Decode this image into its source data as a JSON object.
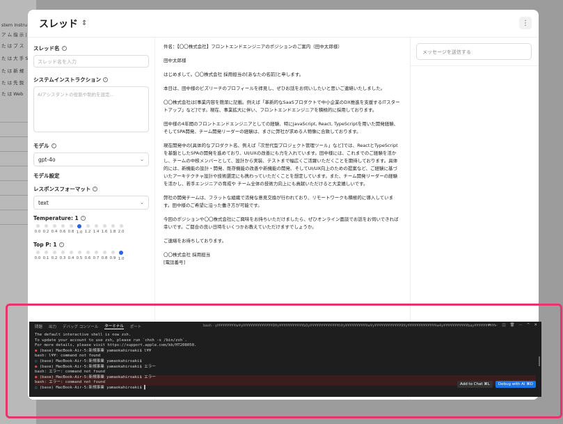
{
  "background_sidebar": [
    "stem Instru",
    "ア ム 指 示 |",
    "た は ブ ス",
    "た は 大 手 S",
    "た は 新 規",
    "た は 先 鋭",
    "た は Web"
  ],
  "modal": {
    "title": "スレッド",
    "thread_name_label": "スレッド名",
    "thread_name_placeholder": "スレッド名を入力",
    "system_instruction_label": "システムインストラクション",
    "system_instruction_placeholder": "AIアシスタントの役割や制約を設定...",
    "model_label": "モデル",
    "model_value": "gpt-4o",
    "model_settings_label": "モデル設定",
    "response_format_label": "レスポンスフォーマット",
    "response_format_value": "text",
    "temperature_label": "Temperature: 1",
    "temperature_ticks": [
      "0.0",
      "0.2",
      "0.4",
      "0.6",
      "0.8",
      "1.0",
      "1.2",
      "1.4",
      "1.6",
      "1.8",
      "2.0"
    ],
    "temperature_value": 1.0,
    "top_p_label": "Top P: 1",
    "top_p_ticks": [
      "0.0",
      "0.1",
      "0.2",
      "0.3",
      "0.4",
      "0.5",
      "0.6",
      "0.7",
      "0.8",
      "0.9",
      "1.0"
    ],
    "top_p_value": 1.0,
    "message_placeholder": "メッセージを送信する"
  },
  "email": {
    "subject": "件名：【〇〇株式会社】フロントエンドエンジニアのポジションのご案内（田中太郎様）",
    "salutation": "田中太郎様",
    "p1": "はじめまして。〇〇株式会社 採用担当の[あなたの名前]と申します。",
    "p2": "本日は、田中様のビズリーチのプロフィールを拝見し、ぜひお話をお伺いしたいと思いご連絡いたしました。",
    "p3": "〇〇株式会社は[事業内容を簡潔に記載。例えば「革新的なSaaSプロダクトで中小企業のDX推進を支援するITスタートアップ」など]です。現在、事業拡大に伴い、フロントエンドエンジニアを積極的に採用しております。",
    "p4": "田中様の4年間のフロントエンドエンジニアとしての経験、特にJavaScript, React, TypeScriptを用いた開発経験、そしてSPA開発、チーム開発リーダーの経験は、まさに弊社が求める人物像に合致しております。",
    "p5": "現在開発中の[具体的なプロダクト名、例えば「次世代型プロジェクト管理ツール」など]では、ReactとTypeScriptを基盤としたSPAの開発を進めており、UI/UXの改善にも力を入れています。田中様には、これまでのご経験を活かし、チームの中核メンバーとして、設計から実装、テストまで幅広くご活躍いただくことを期待しております。具体的には、新機能の設計・開発、既存機能の改善や新機能の開発、そしてUI/UX向上のための提案など、ご経験に基づいたアーキテクチャ設計や技術選定にも携わっていただくことを想定しています。また、チーム開発リーダーの経験を活かし、若手エンジニアの育成や チーム全体の技術力向上にも貢献いただけると大変嬉しいです。",
    "p6": "弊社の開発チームは、フラットな組織で活発な意見交換が行われており、リモートワークも積極的に導入しています。田中様のご希望に沿った働き方が可能です。",
    "p7": "今回のポジションや〇〇株式会社にご興味をお持ちいただけましたら、ぜひオンライン面談でお話をお伺いできれば幸いです。ご都合の良い日時をいくつかお教えていただけますでしょうか。",
    "p8": "ご連絡をお待ちしております。",
    "sig1": "〇〇株式会社 採用担当",
    "sig2": "[電話番号]"
  },
  "terminal": {
    "tabs": [
      "問題",
      "出力",
      "デバッグ コンソール",
      "ターミナル",
      "ポート"
    ],
    "active_tab": "ターミナル",
    "shell_label": "bash - yl¥¥¥¥¥¥¥¥w¥yl¥¥¥¥¥¥¥¥¥¥¥¥¥9¥y¥¥¥¥¥¥¥¥¥¥¥b0y¥¥¥¥¥¥¥¥¥¥¥¥¥h¥y¥¥¥¥¥¥¥¥¥¥w¥y¥¥¥¥¥¥¥¥¥¥¥¥9¥y¥¥¥¥¥¥¥¥¥¥¥¥¥w4y¥¥¥¥¥¥¥¥¥¥¥bay¥¥¥¥¥¥¥¥¥¥¥¥¥9by¥¥¥¥¥¥¥¥¥¥¥w6y¥¥¥¥¥¥¥¥¥¥¥¥w5y¥¥¥¥¥¥¥¥¥¥¥¥fad",
    "lines": [
      "The default interactive shell is now zsh.",
      "To update your account to use zsh, please run `chsh -s /bin/zsh`.",
      "For more details, please visit https://support.apple.com/kb/HT208050.",
      "(base) MacBook-Air-5:新規事業 yamaokahiroaki$ l¥¥",
      "bash: l¥¥: command not found",
      "(base) MacBook-Air-5:新規事業 yamaokahiroaki$",
      "(base) MacBook-Air-5:新規事業 yamaokahiroaki$ エラー",
      "bash: エラー: command not found",
      "(base) MacBook-Air-5:新規事業 yamaokahiroaki$ エラー",
      "bash: エラー: command not found",
      "(base) MacBook-Air-5:新規事業 yamaokahiroaki$"
    ],
    "add_to_chat": "Add to Chat ⌘L",
    "debug_with_ai": "Debug with AI ⌘D",
    "controls": [
      "+",
      "⌵",
      "◫",
      "🗑",
      "···",
      "^",
      "✕"
    ]
  }
}
